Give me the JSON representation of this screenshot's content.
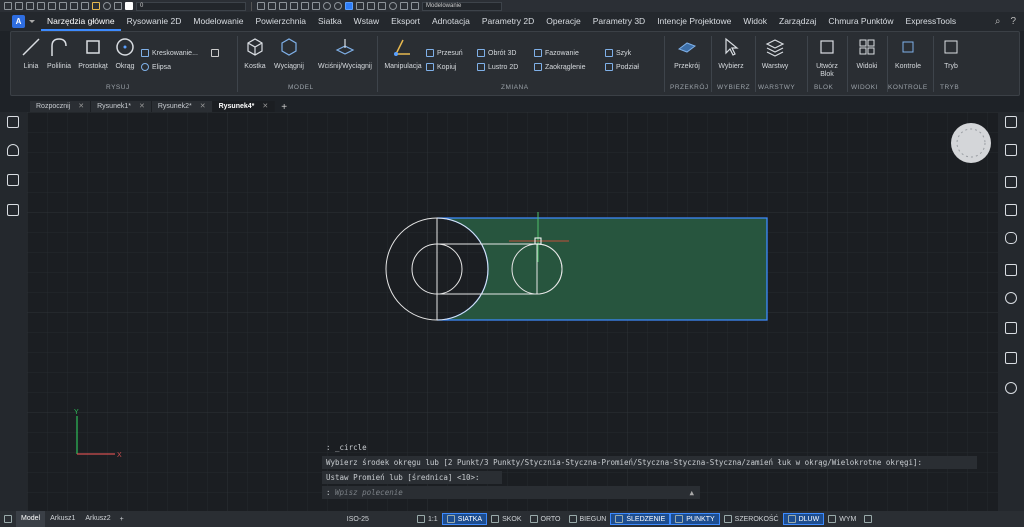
{
  "quick_access": {
    "view_dropdown": "0",
    "workspace_dropdown": "Modelowanie"
  },
  "menu_tabs": [
    "Narzędzia główne",
    "Rysowanie 2D",
    "Modelowanie",
    "Powierzchnia",
    "Siatka",
    "Wstaw",
    "Eksport",
    "Adnotacja",
    "Parametry 2D",
    "Operacje",
    "Parametry 3D",
    "Intencje Projektowe",
    "Widok",
    "Zarządzaj",
    "Chmura Punktów",
    "ExpressTools"
  ],
  "ribbon": {
    "draw": {
      "line": "Linia",
      "polyline": "Polilinia",
      "rectangle": "Prostokąt",
      "circle": "Okrąg",
      "hatch": "Kreskowanie...",
      "ellipse": "Elipsa",
      "label": "RYSUJ"
    },
    "model": {
      "box": "Kostka",
      "extrude": "Wyciągnij",
      "presspull": "Wciśnij/Wyciągnij",
      "label": "MODEL"
    },
    "modify": {
      "manipulate": "Manipulacja",
      "move": "Przesuń",
      "copy": "Kopiuj",
      "rotate3d": "Obrót 3D",
      "mirror2d": "Lustro 2D",
      "chamfer": "Fazowanie",
      "fillet": "Zaokrąglenie",
      "array": "Szyk",
      "split": "Podział",
      "label": "ZMIANA"
    },
    "section": {
      "btn": "Przekrój",
      "label": "PRZEKRÓJ"
    },
    "select": {
      "btn": "Wybierz",
      "label": "WYBIERZ"
    },
    "layers": {
      "btn": "Warstwy",
      "label": "WARSTWY"
    },
    "block": {
      "btn1": "Utwórz",
      "btn2": "Blok",
      "label": "BLOK"
    },
    "views": {
      "btn": "Widoki",
      "label": "WIDOKI"
    },
    "controls": {
      "btn": "Kontrole",
      "label": "KONTROLE"
    },
    "mode": {
      "btn": "Tryb",
      "label": "TRYB"
    }
  },
  "doc_tabs": [
    {
      "label": "Rozpocznij"
    },
    {
      "label": "Rysunek1*"
    },
    {
      "label": "Rysunek2*"
    },
    {
      "label": "Rysunek4*"
    }
  ],
  "ucs": {
    "x": "X",
    "y": "Y"
  },
  "command_line": {
    "history": [
      ": _circle",
      "Wybierz środek okręgu lub [2 Punkt/3 Punkty/Stycznia-Styczna-Promień/Styczna-Styczna-Styczna/zamień łuk w okrąg/Wielokrotne okręgi]:",
      "Ustaw Promień lub [średnica] <10>:"
    ],
    "prompt": ":",
    "placeholder": "Wpisz polecenie"
  },
  "status_bar": {
    "layout_tabs": [
      "Model",
      "Arkusz1",
      "Arkusz2"
    ],
    "scale": "ISO-25",
    "annot_scale": "1:1",
    "toggles": [
      "SIATKA",
      "SKOK",
      "ORTO",
      "BIEGUN",
      "ŚLEDZENIE",
      "PUNKTY",
      "SZEROKOŚĆ",
      "DLUW",
      "WYM"
    ]
  }
}
